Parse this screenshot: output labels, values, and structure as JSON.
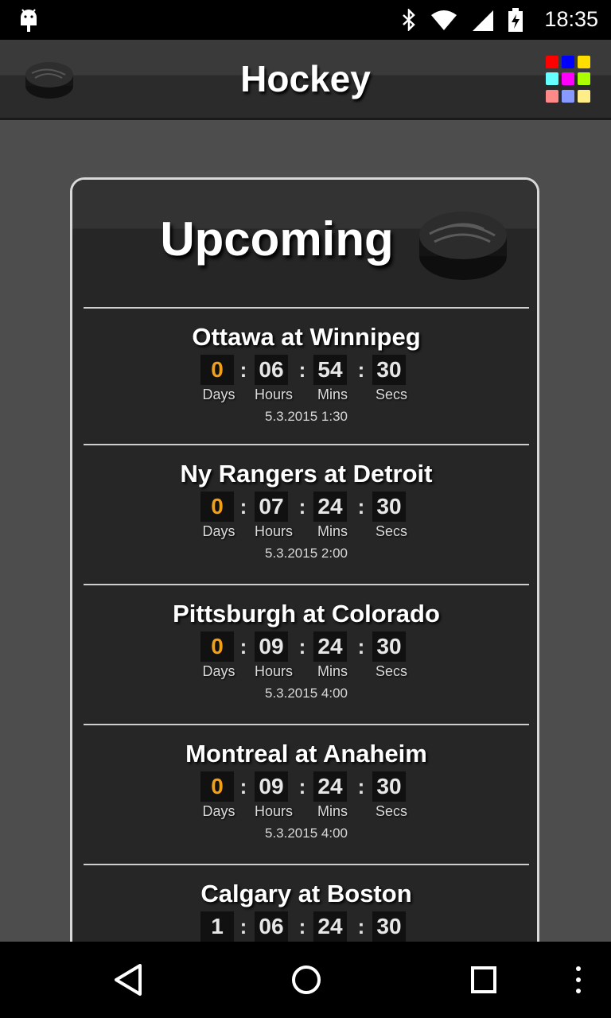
{
  "status": {
    "time": "18:35"
  },
  "app": {
    "title": "Hockey"
  },
  "card": {
    "title": "Upcoming"
  },
  "units": {
    "days": "Days",
    "hours": "Hours",
    "mins": "Mins",
    "secs": "Secs"
  },
  "games": [
    {
      "name": "Ottawa at Winnipeg",
      "days": "0",
      "hours": "06",
      "mins": "54",
      "secs": "30",
      "date": "5.3.2015  1:30"
    },
    {
      "name": "Ny Rangers at Detroit",
      "days": "0",
      "hours": "07",
      "mins": "24",
      "secs": "30",
      "date": "5.3.2015  2:00"
    },
    {
      "name": "Pittsburgh at Colorado",
      "days": "0",
      "hours": "09",
      "mins": "24",
      "secs": "30",
      "date": "5.3.2015  4:00"
    },
    {
      "name": "Montreal at Anaheim",
      "days": "0",
      "hours": "09",
      "mins": "24",
      "secs": "30",
      "date": "5.3.2015  4:00"
    },
    {
      "name": "Calgary at Boston",
      "days": "1",
      "hours": "06",
      "mins": "24",
      "secs": "30",
      "date": ""
    }
  ],
  "colors": {
    "days_accent": "#f2a017",
    "grid": [
      "#ff0000",
      "#0000ff",
      "#ffdd00",
      "#66ffff",
      "#ff00ff",
      "#aaff00",
      "#ff8888",
      "#8899ff",
      "#ffee88"
    ]
  },
  "icons": {
    "status": [
      "android-icon",
      "bluetooth-icon",
      "wifi-icon",
      "signal-icon",
      "battery-icon"
    ],
    "nav": [
      "back-icon",
      "home-icon",
      "recents-icon",
      "overflow-menu-icon"
    ]
  }
}
